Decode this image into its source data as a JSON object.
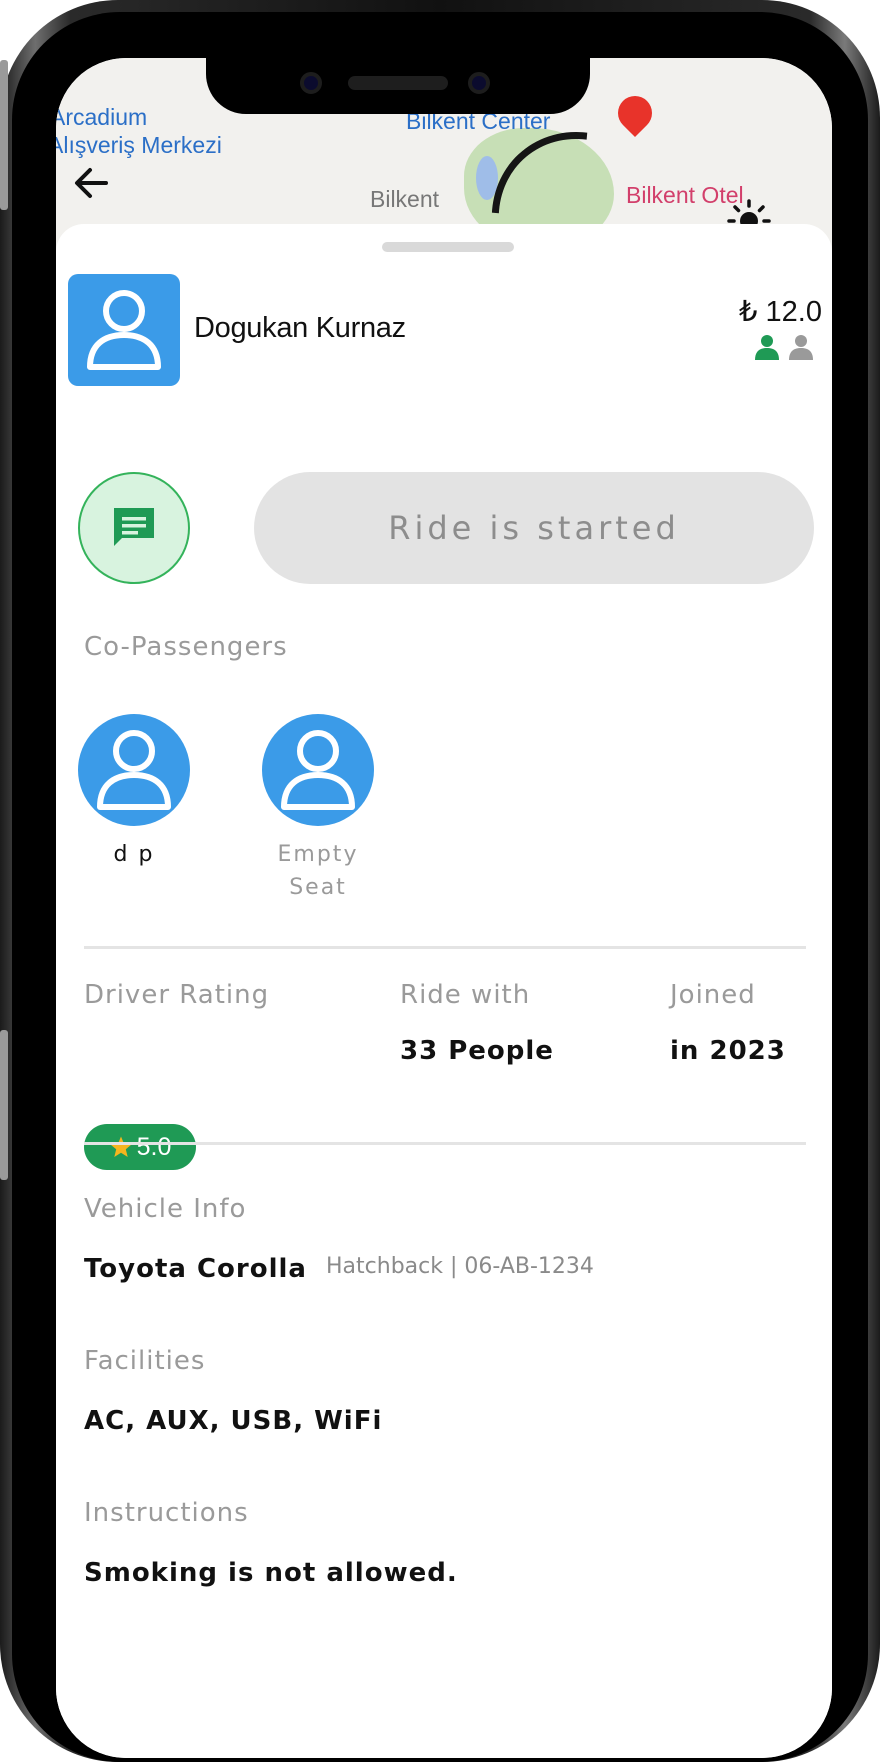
{
  "map": {
    "labels": [
      "Arcadium",
      "Alışveriş Merkezi",
      "Bilkent Center",
      "Bilkent",
      "Bilkent Otel"
    ]
  },
  "driver": {
    "name": "Dogukan Kurnaz",
    "price": "₺ 12.0",
    "seats_total": 2,
    "seats_filled": 1
  },
  "actions": {
    "ride_status_label": "Ride is started"
  },
  "co_passengers": {
    "title": "Co-Passengers",
    "items": [
      {
        "name": "d p"
      },
      {
        "name": "Empty\nSeat"
      }
    ]
  },
  "stats": {
    "rating_label": "Driver Rating",
    "rating_value": "5.0",
    "ride_with_label": "Ride with",
    "ride_with_value": "33 People",
    "joined_label": "Joined",
    "joined_value": "in 2023"
  },
  "vehicle": {
    "title": "Vehicle Info",
    "name": "Toyota Corolla",
    "details": "Hatchback | 06-AB-1234"
  },
  "facilities": {
    "title": "Facilities",
    "value": "AC, AUX, USB, WiFi"
  },
  "instructions": {
    "title": "Instructions",
    "value": "Smoking is not allowed."
  },
  "colors": {
    "accent_blue": "#3b9be8",
    "success_green": "#1f9a55",
    "chat_bg": "#d8f3df",
    "disabled_grey": "#e3e3e3"
  }
}
